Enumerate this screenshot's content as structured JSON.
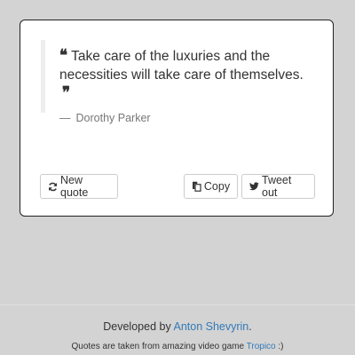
{
  "colors": {
    "page_background": "#d3d3d3",
    "card_background": "#ffffff",
    "link": "#337ab7",
    "muted_text": "#777777"
  },
  "quote": {
    "text": "Take care of the luxuries and the necessities will take care of themselves.",
    "author": "Dorothy Parker",
    "author_prefix": "—",
    "open_quote_icon": "quote-left-icon",
    "close_quote_icon": "quote-right-icon"
  },
  "actions": {
    "new_quote_label": "New quote",
    "new_quote_icon": "refresh-icon",
    "copy_label": "Copy",
    "copy_icon": "copy-icon",
    "tweet_label": "Tweet out",
    "tweet_icon": "twitter-icon"
  },
  "footer": {
    "developed_by_prefix": "Developed by ",
    "developer_name": "Anton Shevyrin",
    "developed_by_suffix": ".",
    "source_prefix": "Quotes are taken from amazing video game ",
    "source_name": "Tropico",
    "source_suffix": " :)"
  }
}
